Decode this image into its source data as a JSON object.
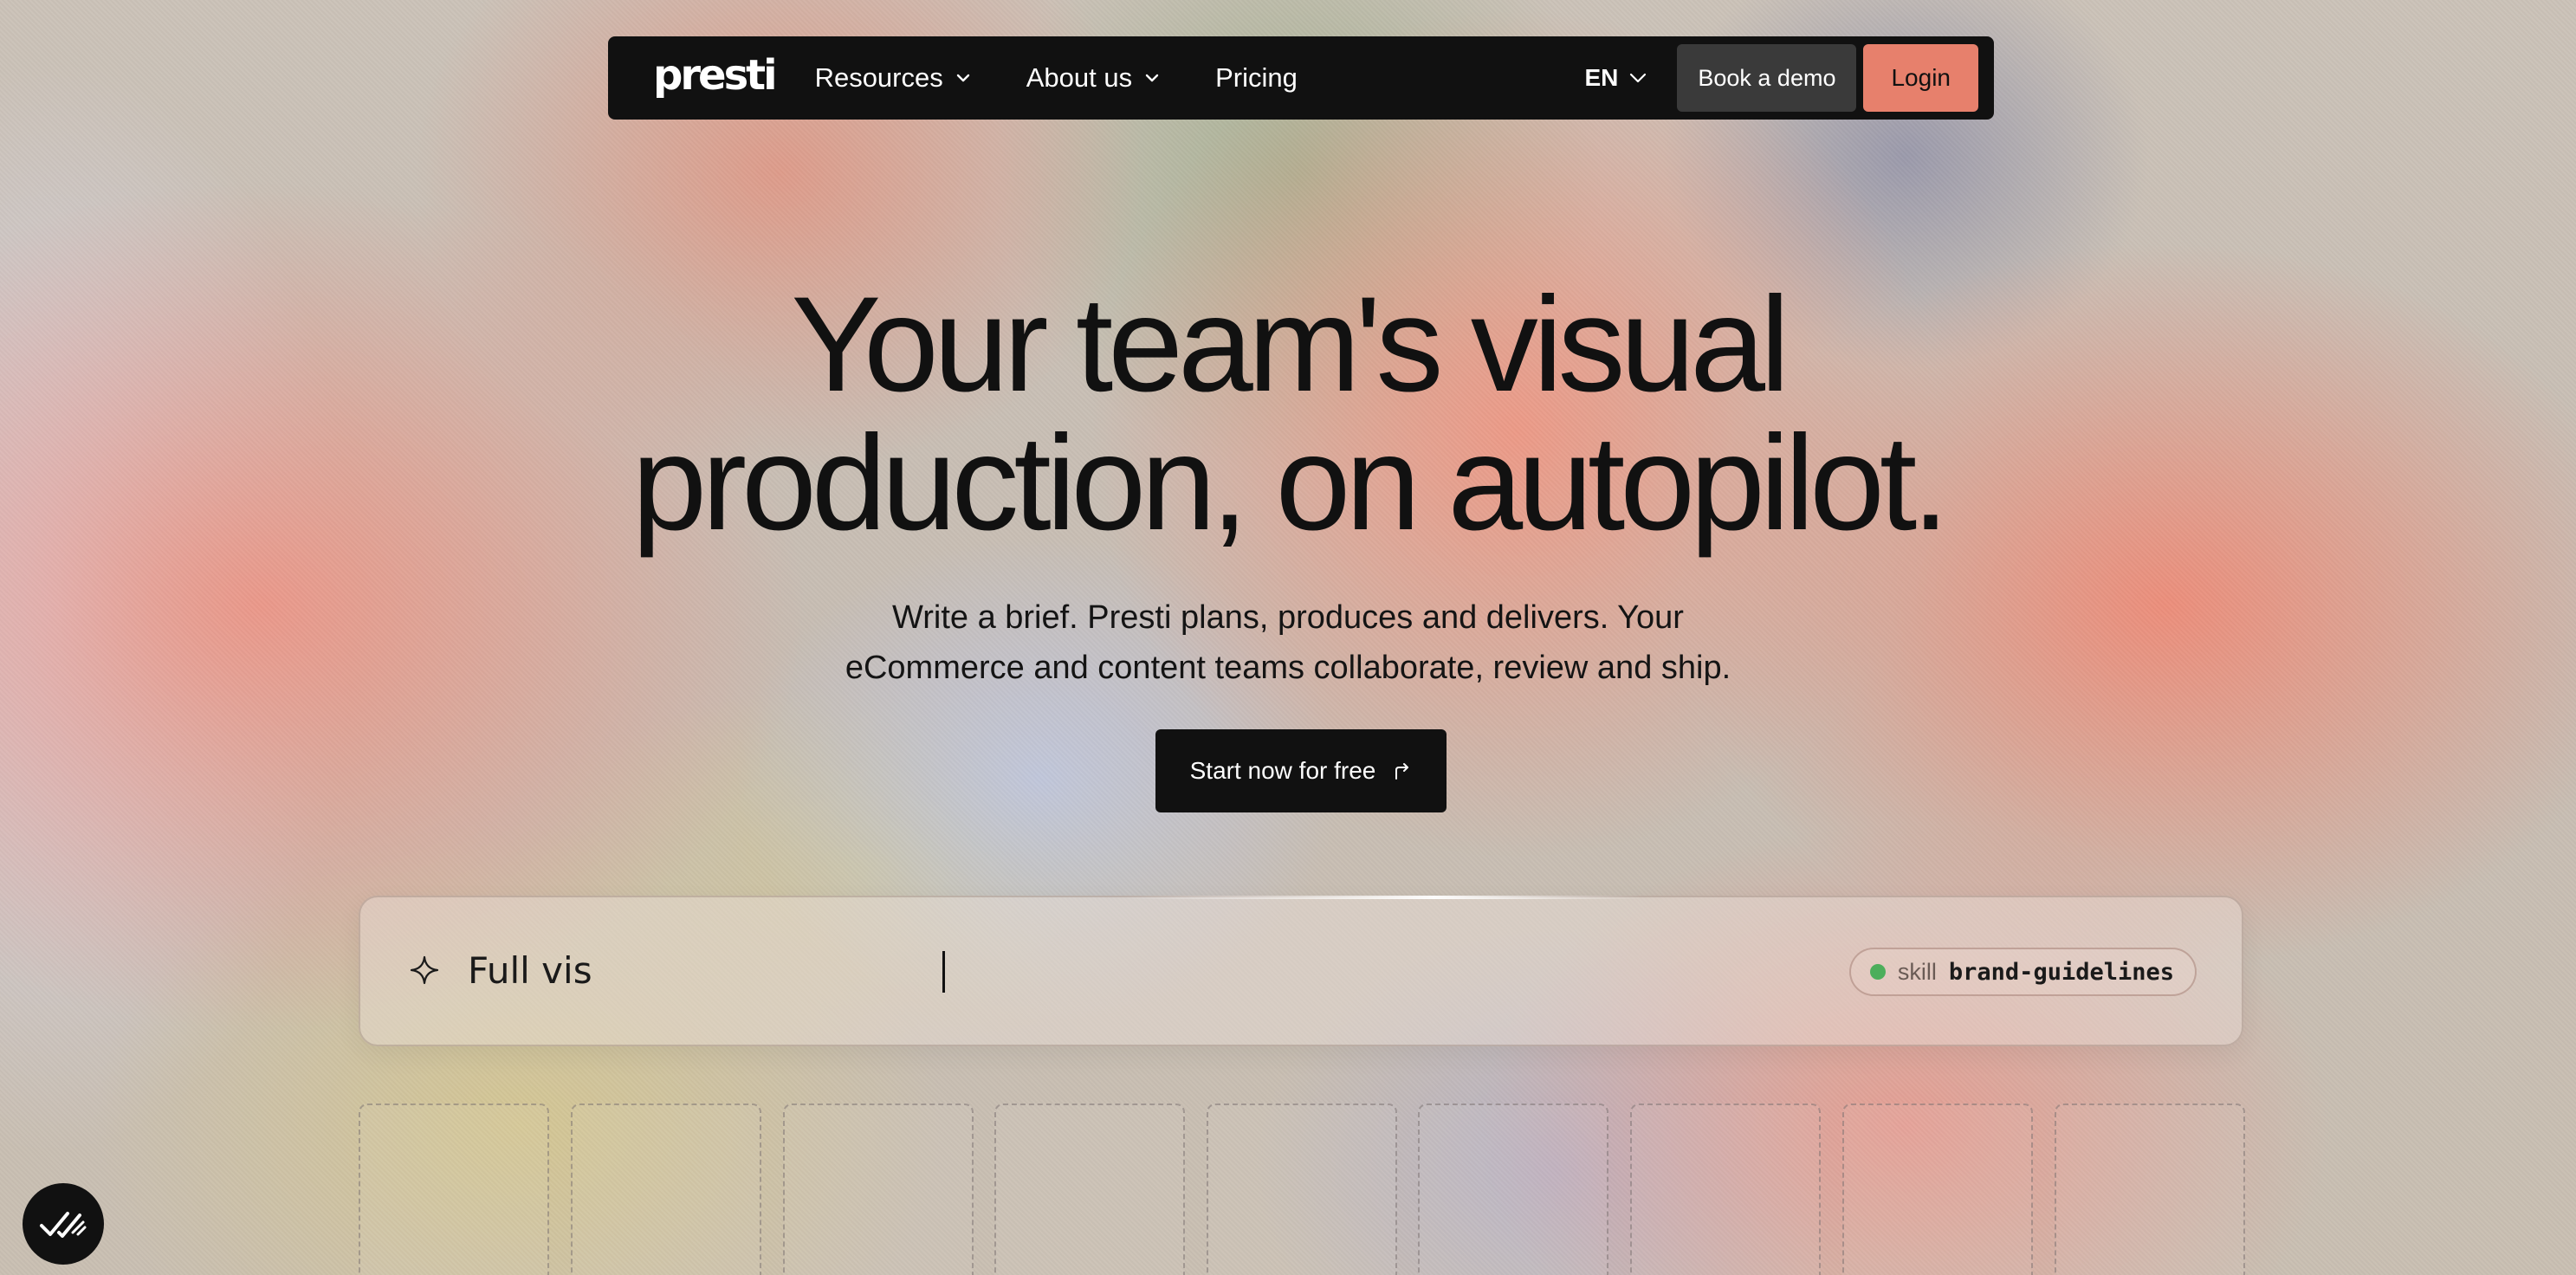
{
  "nav": {
    "logo": "presti",
    "items": [
      {
        "label": "Resources",
        "has_dropdown": true
      },
      {
        "label": "About us",
        "has_dropdown": true
      },
      {
        "label": "Pricing",
        "has_dropdown": false
      }
    ],
    "language": "EN",
    "demo_label": "Book a demo",
    "login_label": "Login"
  },
  "hero": {
    "title_line1": "Your team's visual",
    "title_line2": "production, on autopilot.",
    "subtitle_line1": "Write a brief. Presti plans, produces and delivers. Your",
    "subtitle_line2": "eCommerce and content teams collaborate, review and ship.",
    "cta_label": "Start now for free"
  },
  "prompt": {
    "value": "Full vis",
    "icon": "sparkle-icon",
    "skill_label": "skill",
    "skill_name": "brand-guidelines",
    "skill_status_color": "#4cae5b"
  },
  "tiles": {
    "count": 9
  },
  "badge": {
    "icon": "double-check-icon"
  },
  "colors": {
    "nav_bg": "#111111",
    "login_accent": "#e7806c",
    "demo_bg": "#3a3a3a"
  }
}
